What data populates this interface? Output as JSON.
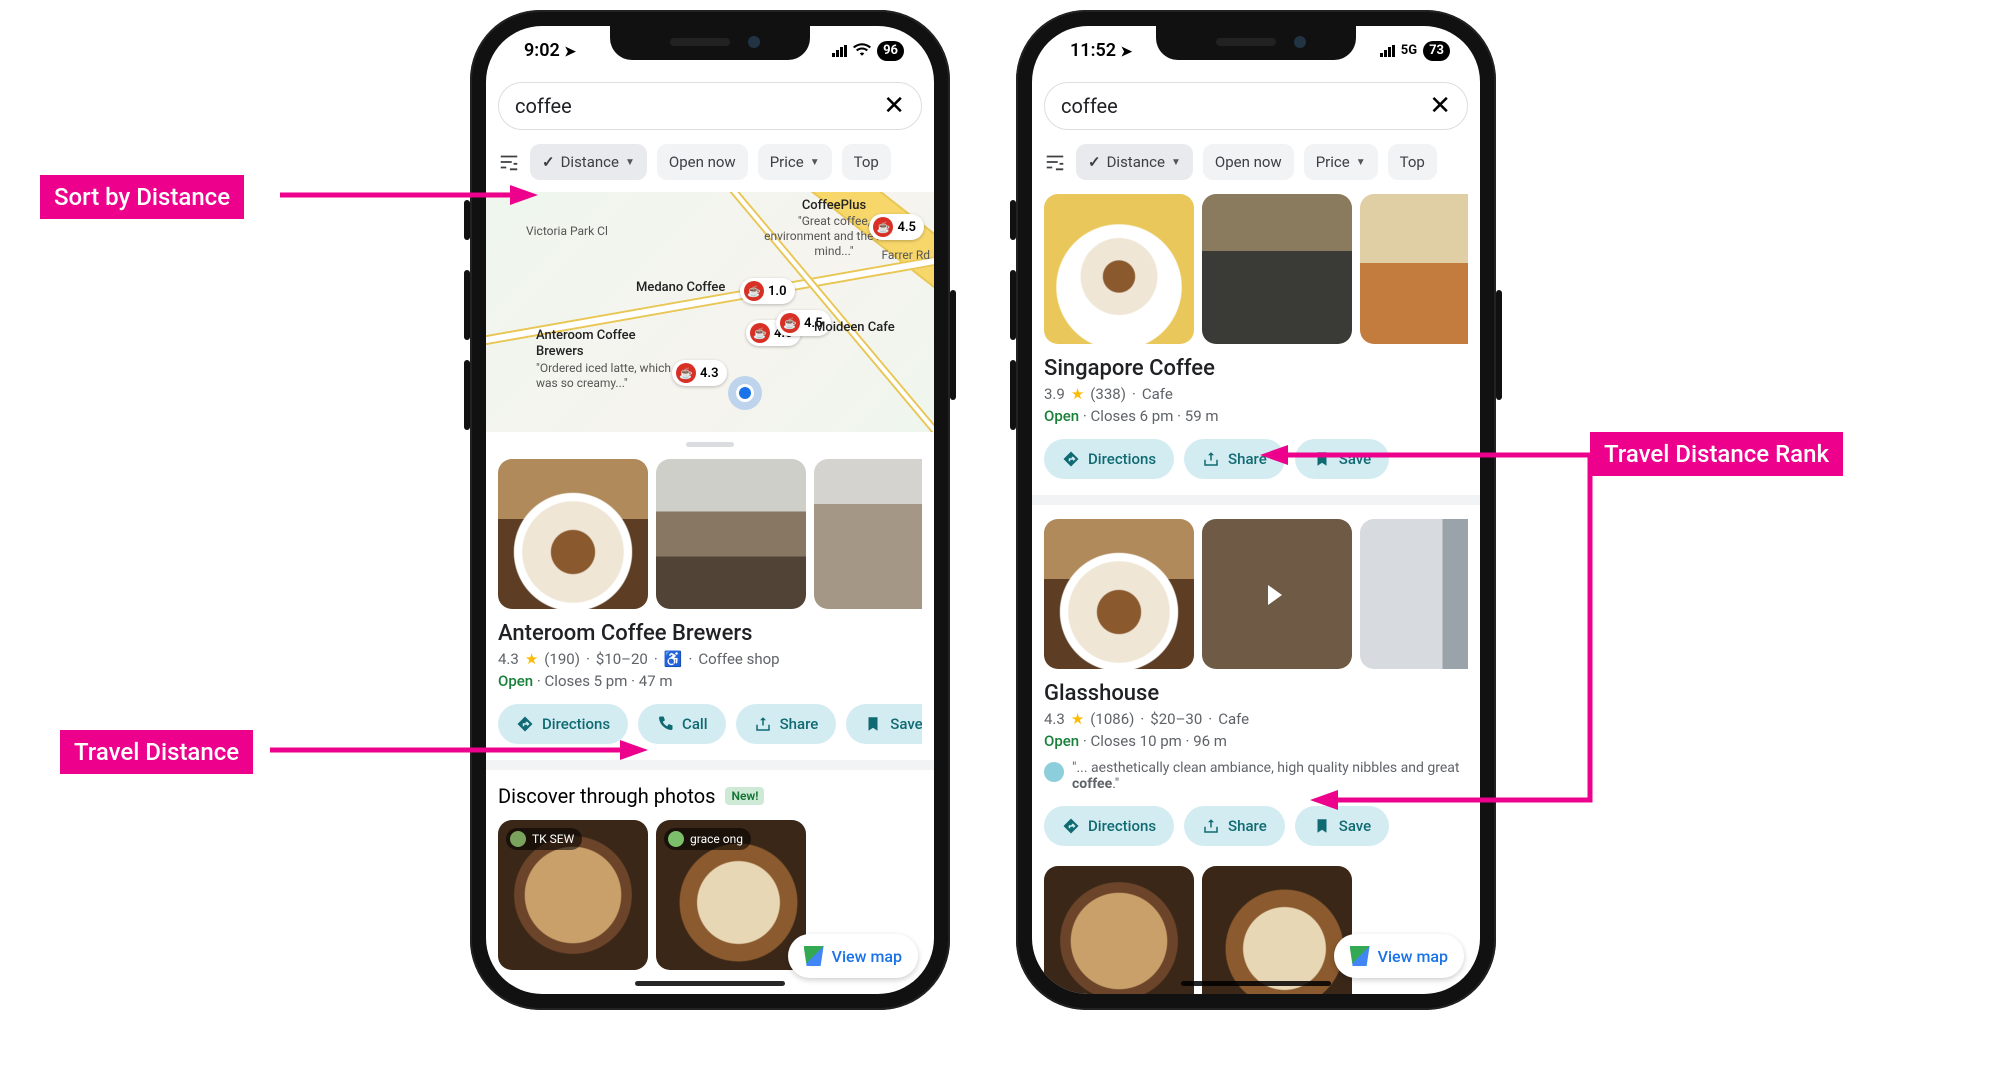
{
  "phoneA": {
    "status": {
      "time": "9:02",
      "battery": "96"
    },
    "search": {
      "query": "coffee"
    },
    "chips": {
      "distance": "Distance",
      "open_now": "Open now",
      "price": "Price",
      "top": "Top"
    },
    "map": {
      "pins": [
        {
          "name": "CoffeePlus",
          "rating": "4.5",
          "sub": "\"Great coffee, environment and the most mind...\""
        },
        {
          "name": "Medano Coffee",
          "rating": "1.0"
        },
        {
          "name": "",
          "rating": "4.0"
        },
        {
          "name": "Moideen Cafe",
          "rating": ""
        },
        {
          "name": "Anteroom Coffee Brewers",
          "rating": "4.3",
          "sub": "\"Ordered iced latte, which was so creamy...\""
        },
        {
          "name": "",
          "rating": "4.5"
        }
      ],
      "roads": [
        "Victoria Park Cl",
        "Farrer Rd"
      ]
    },
    "place": {
      "name": "Anteroom Coffee Brewers",
      "rating": "4.3",
      "reviews": "(190)",
      "price": "$10–20",
      "category": "Coffee shop",
      "open": "Open",
      "closes": "Closes 5 pm",
      "distance": "47 m"
    },
    "actions": {
      "directions": "Directions",
      "call": "Call",
      "share": "Share",
      "save": "Save"
    },
    "discover": {
      "title": "Discover through photos",
      "new": "New!",
      "users": [
        "TK SEW",
        "grace ong"
      ]
    },
    "viewmap": "View map"
  },
  "phoneB": {
    "status": {
      "time": "11:52",
      "net": "5G",
      "battery": "73"
    },
    "search": {
      "query": "coffee"
    },
    "chips": {
      "distance": "Distance",
      "open_now": "Open now",
      "price": "Price",
      "top": "Top"
    },
    "place1": {
      "name": "Singapore Coffee",
      "rating": "3.9",
      "reviews": "(338)",
      "category": "Cafe",
      "open": "Open",
      "closes": "Closes 6 pm",
      "distance": "59 m"
    },
    "place2": {
      "name": "Glasshouse",
      "rating": "4.3",
      "reviews": "(1086)",
      "price": "$20–30",
      "category": "Cafe",
      "open": "Open",
      "closes": "Closes 10 pm",
      "distance": "96 m",
      "review": "\"... aesthetically clean ambiance, high quality nibbles and great ",
      "review_bold": "coffee",
      "review_tail": ".\""
    },
    "actions": {
      "directions": "Directions",
      "share": "Share",
      "save": "Save"
    },
    "viewmap": "View map"
  },
  "annotations": {
    "sort": "Sort by Distance",
    "dist": "Travel Distance",
    "rank": "Travel Distance Rank"
  }
}
